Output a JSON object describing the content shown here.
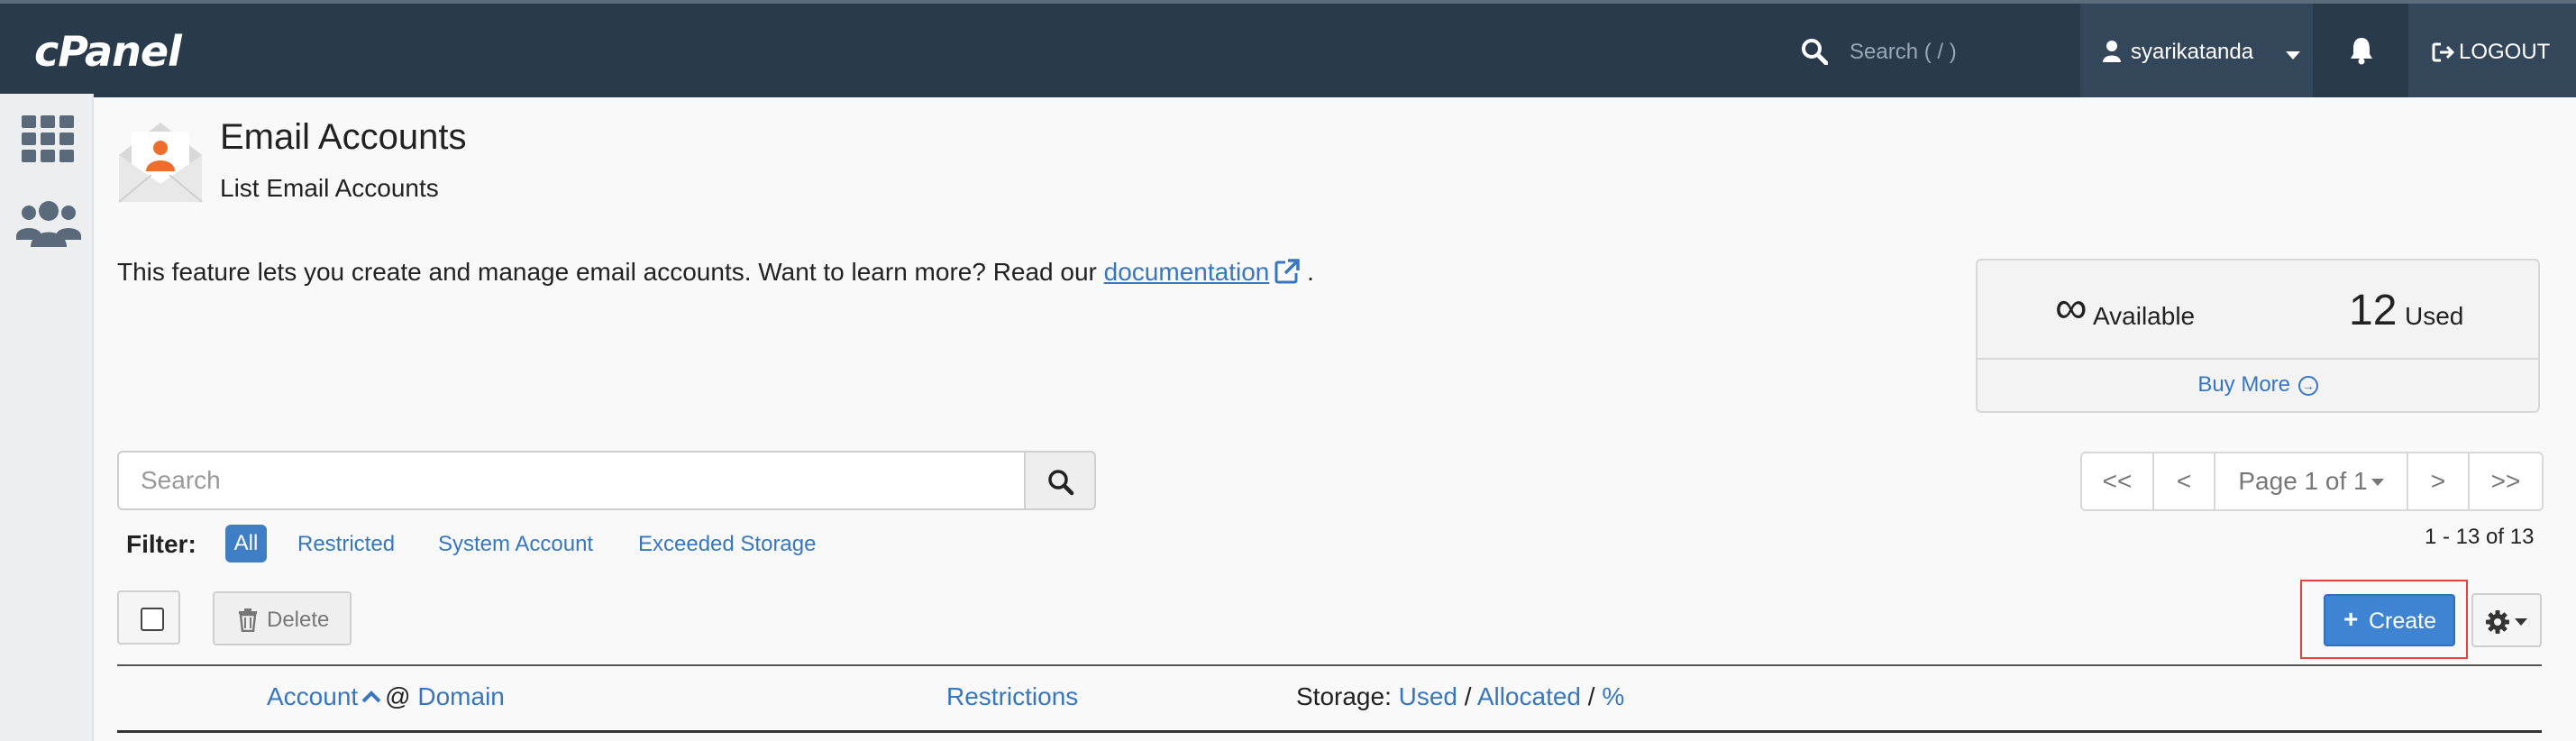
{
  "topbar": {
    "logo": "cPanel",
    "search_placeholder": "Search ( / )",
    "username": "syarikatanda",
    "logout_label": "LOGOUT"
  },
  "page": {
    "title": "Email Accounts",
    "subtitle": "List Email Accounts",
    "intro_text": "This feature lets you create and manage email accounts. Want to learn more? Read our",
    "intro_link": "documentation",
    "intro_end": "."
  },
  "stats": {
    "available_value": "∞",
    "available_label": "Available",
    "used_value": "12",
    "used_label": "Used",
    "buy_more": "Buy More"
  },
  "search": {
    "placeholder": "Search"
  },
  "pagination": {
    "first": "<<",
    "prev": "<",
    "page_label": "Page 1 of 1",
    "next": ">",
    "last": ">>",
    "count": "1 - 13 of 13"
  },
  "filter": {
    "label": "Filter:",
    "options": [
      "All",
      "Restricted",
      "System Account",
      "Exceeded Storage"
    ],
    "selected": "All"
  },
  "actions": {
    "delete_label": "Delete",
    "create_label": "Create"
  },
  "table": {
    "col_account": "Account",
    "col_at": "@",
    "col_domain": "Domain",
    "col_restrictions": "Restrictions",
    "storage_prefix": "Storage:",
    "storage_used": "Used",
    "storage_sep1": "/",
    "storage_allocated": "Allocated",
    "storage_sep2": "/",
    "storage_percent": "%"
  },
  "colors": {
    "topbar": "#293a4a",
    "accent": "#3f84d2",
    "link": "#3877c0",
    "highlight": "#e0443a"
  }
}
